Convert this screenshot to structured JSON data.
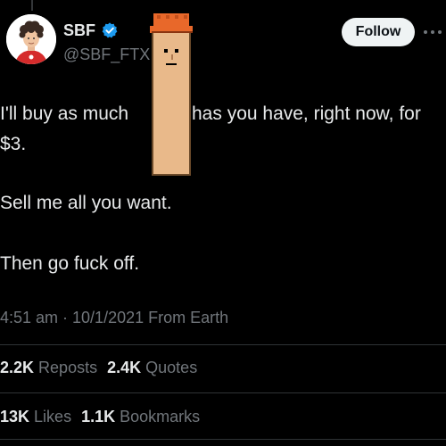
{
  "author": {
    "display_name": "SBF",
    "handle": "@SBF_FTX",
    "verified_icon": "verified-badge-icon",
    "badge_color": "#1d9bf0"
  },
  "follow_label": "Follow",
  "more_icon": "more-options-icon",
  "tweet": {
    "line1_a": "I'll buy as much",
    "line1_b": "has you have, right now, for",
    "line2": "$3.",
    "line3": "Sell me all you want.",
    "line4": "Then go fuck off."
  },
  "meta": {
    "timestamp": "4:51 am · 10/1/2021 From Earth"
  },
  "stats": {
    "reposts_count": "2.2K",
    "reposts_label": "Reposts",
    "quotes_count": "2.4K",
    "quotes_label": "Quotes",
    "likes_count": "13K",
    "likes_label": "Likes",
    "bookmarks_count": "1.1K",
    "bookmarks_label": "Bookmarks"
  },
  "colors": {
    "background": "#000000",
    "text": "#e7e9ea",
    "secondary": "#71767b",
    "accent": "#1d9bf0",
    "pixel_skin": "#e9b98a",
    "pixel_hat": "#e8682a"
  }
}
